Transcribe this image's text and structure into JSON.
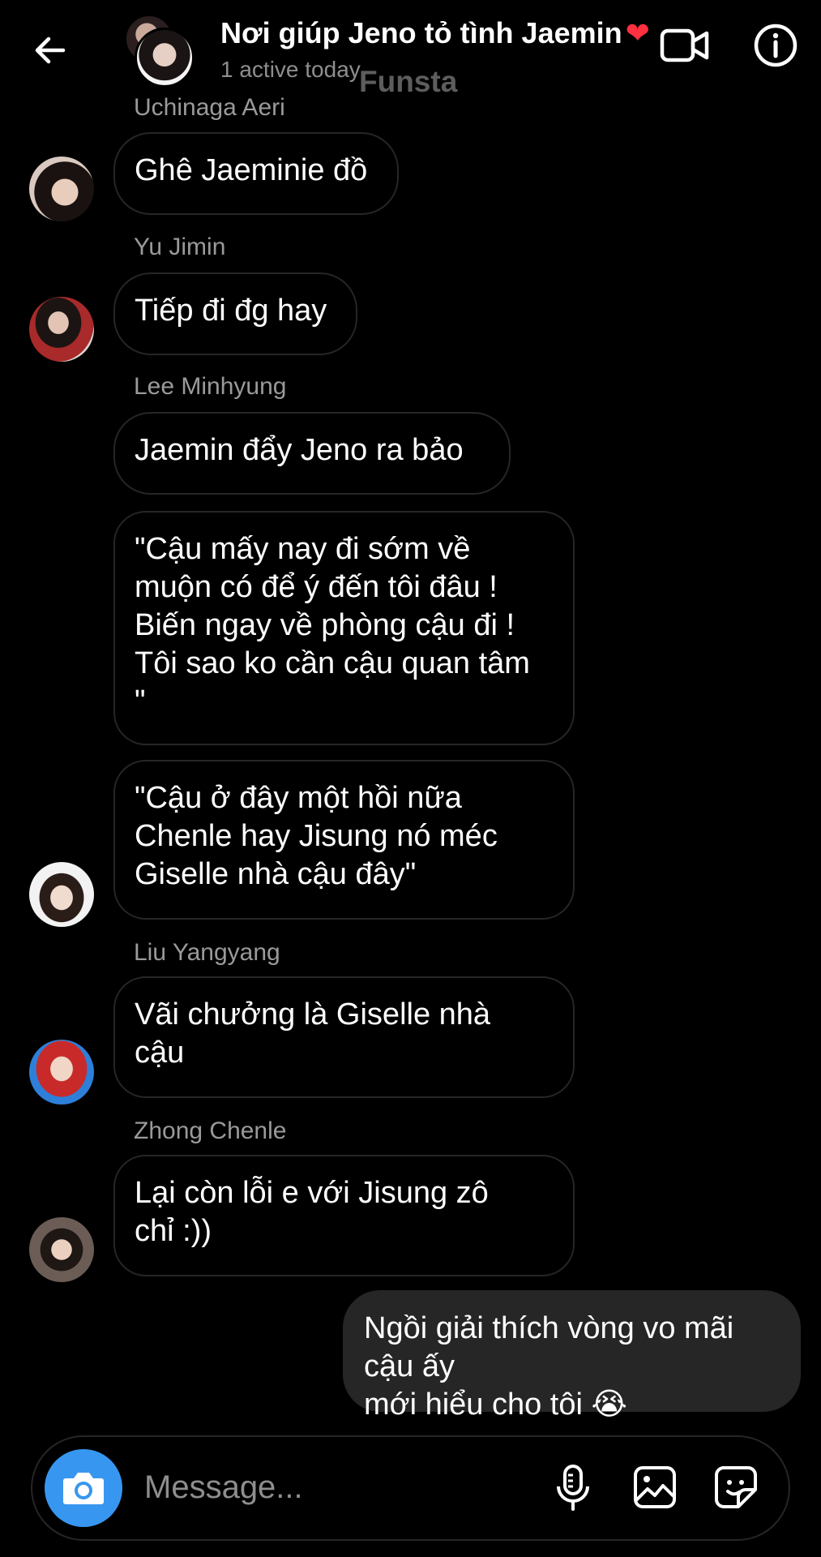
{
  "header": {
    "back_icon": "arrow-left-icon",
    "title": "Nơi giúp Jeno tỏ tình Jaemin",
    "title_emoji": "❤",
    "status": "1 active today",
    "watermark": "Funsta",
    "video_icon": "video-camera-icon",
    "info_icon": "info-icon"
  },
  "messages": [
    {
      "sender": "Uchinaga Aeri",
      "text": "Ghê Jaeminie đồ"
    },
    {
      "sender": "Yu Jimin",
      "text": "Tiếp đi đg hay"
    },
    {
      "sender": "Lee Minhyung",
      "text": "Jaemin đẩy Jeno ra bảo"
    },
    {
      "sender": "",
      "text": "\"Cậu mấy nay đi sớm về\nmuộn có để ý đến tôi đâu !\nBiến ngay về phòng cậu đi !\nTôi sao ko cần cậu quan tâm\n\""
    },
    {
      "sender": "",
      "text": "\"Cậu ở đây một hồi nữa\nChenle hay Jisung nó méc\nGiselle nhà cậu đây\""
    },
    {
      "sender": "Liu Yangyang",
      "text": "Vãi chưởng là Giselle nhà\ncậu"
    },
    {
      "sender": "Zhong Chenle",
      "text": "Lại còn lỗi e với Jisung zô\nchỉ :))"
    },
    {
      "sender": "me",
      "text": "Ngồi giải thích vòng vo mãi cậu ấy\nmới hiểu cho tôi 😭"
    }
  ],
  "composer": {
    "placeholder": "Message...",
    "camera_icon": "camera-icon",
    "mic_icon": "microphone-icon",
    "gallery_icon": "image-icon",
    "sticker_icon": "sticker-icon"
  },
  "colors": {
    "background": "#000000",
    "accent": "#3797f0",
    "heart": "#ff3040",
    "secondary_text": "#8e8e8e",
    "my_bubble": "#262626"
  }
}
